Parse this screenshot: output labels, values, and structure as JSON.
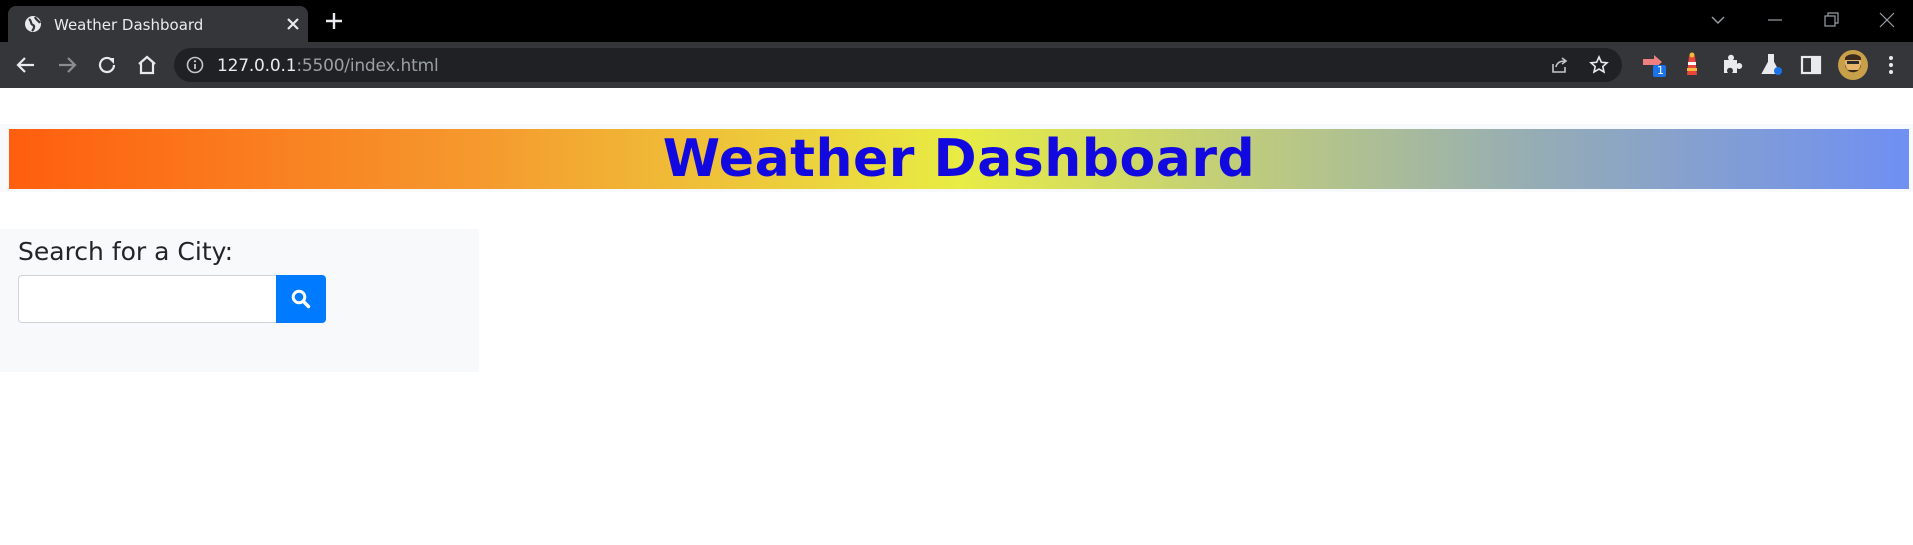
{
  "browser": {
    "tab": {
      "title": "Weather Dashboard"
    },
    "address": {
      "host": "127.0.0.1",
      "rest": ":5500/index.html"
    },
    "extensions": {
      "badge_count": "1"
    },
    "colors": {
      "chrome_dark": "#000000",
      "toolbar": "#35363a",
      "omnibox": "#202124"
    }
  },
  "page": {
    "header": {
      "title": "Weather Dashboard"
    },
    "search": {
      "label": "Search for a City:",
      "input_value": "",
      "placeholder": ""
    },
    "colors": {
      "title": "#1209e0",
      "search_button": "#007bff",
      "panel_bg": "#f8f9fa"
    }
  },
  "icons": {
    "tab_favicon": "globe-icon",
    "tab_close": "close-icon",
    "new_tab": "plus-icon",
    "back": "back-arrow-icon",
    "forward": "forward-arrow-icon",
    "reload": "reload-icon",
    "home": "home-icon",
    "site_info": "info-icon",
    "share": "share-icon",
    "bookmark": "star-icon",
    "search_button": "search-icon"
  }
}
